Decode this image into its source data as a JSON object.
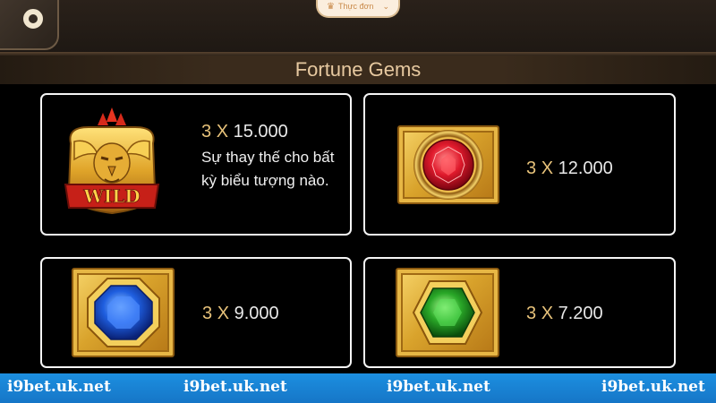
{
  "header": {
    "menu_label": "Thực đơn",
    "menu_icon": "crown-icon"
  },
  "title": "Fortune Gems",
  "cards": [
    {
      "symbol": "wild",
      "count": "3",
      "x": "X",
      "value": "15.000",
      "desc": "Sự thay thế cho bất kỳ biểu tượng nào.",
      "wild_label": "WILD"
    },
    {
      "symbol": "red-gem",
      "count": "3",
      "x": "X",
      "value": "12.000"
    },
    {
      "symbol": "blue-gem",
      "count": "3",
      "x": "X",
      "value": "9.000"
    },
    {
      "symbol": "green-gem",
      "count": "3",
      "x": "X",
      "value": "7.200"
    }
  ],
  "watermark": [
    "i9bet.uk.net",
    "i9bet.uk.net",
    "i9bet.uk.net",
    "i9bet.uk.net"
  ],
  "colors": {
    "accent_gold": "#e7c27a",
    "title": "#e7c9a0",
    "watermark_bar": "#1c8fe0"
  }
}
